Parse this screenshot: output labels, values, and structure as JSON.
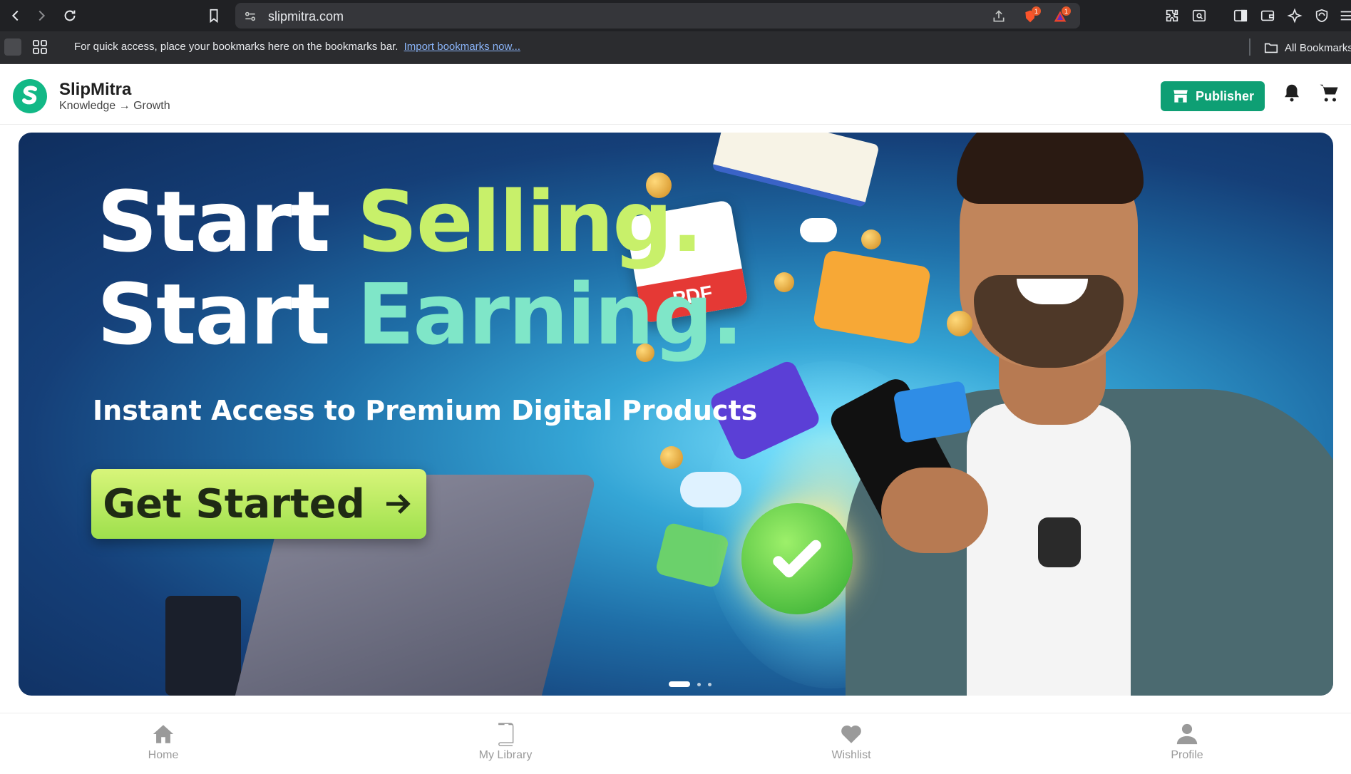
{
  "browser": {
    "url": "slipmitra.com",
    "bookmarks_prompt": "For quick access, place your bookmarks here on the bookmarks bar.",
    "import_link": "Import bookmarks now...",
    "all_bookmarks": "All Bookmarks",
    "brave_badge": "1",
    "rewards_badge": "1"
  },
  "header": {
    "brand_name": "SlipMitra",
    "brand_tagline": "Knowledge → Growth",
    "publisher_label": "Publisher",
    "brand_color": "#0e9f74"
  },
  "hero": {
    "line1_white": "Start ",
    "line1_accent": "Selling.",
    "line2_white": "Start ",
    "line2_accent": "Earning.",
    "subtitle": "Instant Access to Premium Digital Products",
    "cta_label": "Get Started",
    "pdf_label": "PDF",
    "active_slide": 1
  },
  "bottom_nav": {
    "items": [
      {
        "label": "Home",
        "icon": "home-icon"
      },
      {
        "label": "My Library",
        "icon": "library-icon"
      },
      {
        "label": "Wishlist",
        "icon": "heart-icon"
      },
      {
        "label": "Profile",
        "icon": "user-icon"
      }
    ]
  }
}
